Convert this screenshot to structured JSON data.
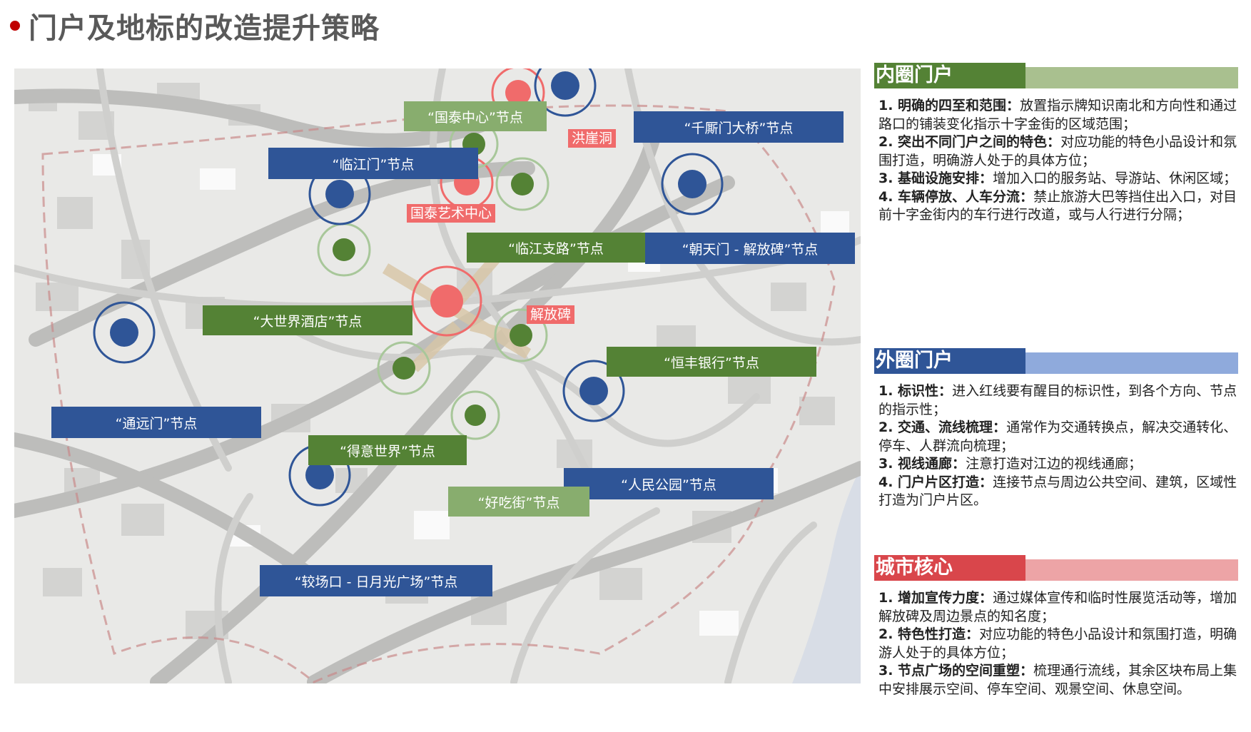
{
  "title": "门户及地标的改造提升策略",
  "colors": {
    "accent_red": "#c00000",
    "node_blue": "#2f5597",
    "node_green": "#548235",
    "node_red": "#f06b6b"
  },
  "map": {
    "blue_nodes": [
      {
        "label": "“千厮门大桥”节点"
      },
      {
        "label": "“临江门”节点"
      },
      {
        "label": "“朝天门 - 解放碑”节点"
      },
      {
        "label": "“通远门”节点"
      },
      {
        "label": "“人民公园”节点"
      },
      {
        "label": "“较场口 - 日月光广场”节点"
      }
    ],
    "green_nodes": [
      {
        "label": "“国泰中心”节点"
      },
      {
        "label": "“临江支路”节点"
      },
      {
        "label": "“大世界酒店”节点"
      },
      {
        "label": "“恒丰银行”节点"
      },
      {
        "label": "“得意世界”节点"
      },
      {
        "label": "“好吃街”节点"
      }
    ],
    "red_tags": [
      "洪崖洞",
      "国泰艺术中心",
      "解放碑"
    ]
  },
  "sections": [
    {
      "heading": "内圈门户",
      "dark_color": "#548235",
      "light_color": "#a9c08f",
      "items": [
        {
          "bold": "1. 明确的四至和范围：",
          "text": "放置指示牌知识南北和方向性和通过路口的铺装变化指示十字金街的区域范围；"
        },
        {
          "bold": "2. 突出不同门户之间的特色：",
          "text": "对应功能的特色小品设计和氛围打造，明确游人处于的具体方位；"
        },
        {
          "bold": "3. 基础设施安排：",
          "text": "增加入口的服务站、导游站、休闲区域；"
        },
        {
          "bold": "4. 车辆停放、人车分流：",
          "text": "禁止旅游大巴等挡住出入口，对目前十字金街内的车行进行改道，或与人行进行分隔；"
        }
      ]
    },
    {
      "heading": "外圈门户",
      "dark_color": "#2f5597",
      "light_color": "#8faadc",
      "items": [
        {
          "bold": "1. 标识性：",
          "text": "进入红线要有醒目的标识性，到各个方向、节点的指示性；"
        },
        {
          "bold": "2. 交通、流线梳理：",
          "text": "通常作为交通转换点，解决交通转化、停车、人群流向梳理；"
        },
        {
          "bold": "3. 视线通廊：",
          "text": "注意打造对江边的视线通廊；"
        },
        {
          "bold": "4. 门户片区打造：",
          "text": "连接节点与周边公共空间、建筑，区域性打造为门户片区。"
        }
      ]
    },
    {
      "heading": "城市核心",
      "dark_color": "#d9464b",
      "light_color": "#eda4a6",
      "items": [
        {
          "bold": "1. 增加宣传力度：",
          "text": "通过媒体宣传和临时性展览活动等，增加解放碑及周边景点的知名度；"
        },
        {
          "bold": "2. 特色性打造：",
          "text": "对应功能的特色小品设计和氛围打造，明确游人处于的具体方位；"
        },
        {
          "bold": "3. 节点广场的空间重塑：",
          "text": "梳理通行流线，其余区块布局上集中安排展示空间、停车空间、观景空间、休息空间。"
        }
      ]
    }
  ]
}
